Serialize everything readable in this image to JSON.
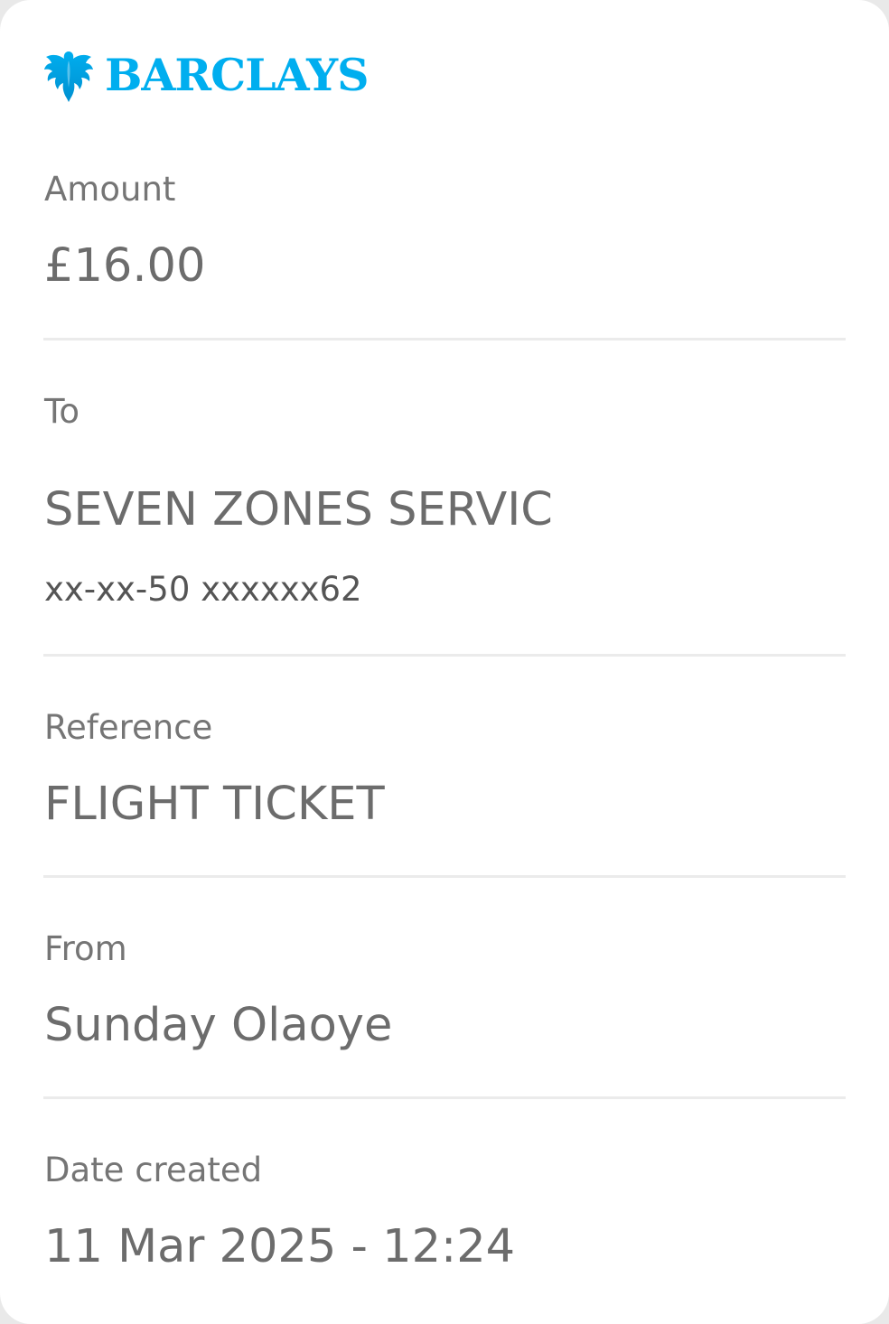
{
  "brand": {
    "name": "BARCLAYS",
    "icon": "eagle-icon",
    "color": "#00aeef"
  },
  "amount": {
    "label": "Amount",
    "value": "£16.00"
  },
  "to": {
    "label": "To",
    "name": "SEVEN ZONES SERVIC",
    "account": "xx-xx-50 xxxxxx62"
  },
  "reference": {
    "label": "Reference",
    "value": "FLIGHT TICKET"
  },
  "from": {
    "label": "From",
    "value": "Sunday Olaoye"
  },
  "date_created": {
    "label": "Date created",
    "value": "11 Mar 2025 - 12:24"
  }
}
